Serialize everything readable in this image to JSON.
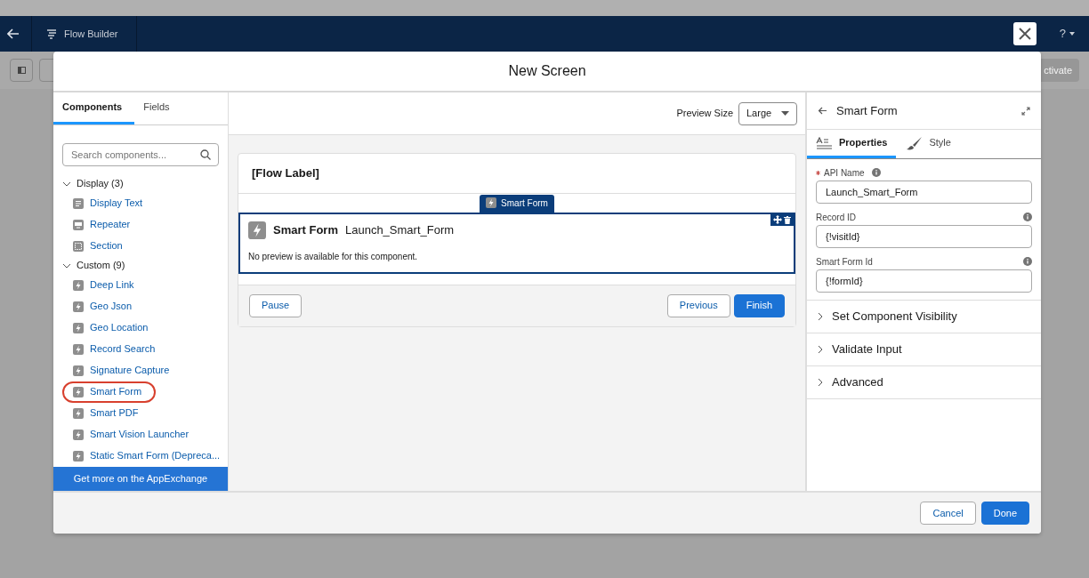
{
  "app_bar": {
    "title": "Flow Builder",
    "help": "?"
  },
  "toolbar": {
    "activate_label": "ctivate"
  },
  "modal": {
    "title": "New Screen",
    "left_tabs": [
      {
        "label": "Components",
        "selected": true
      },
      {
        "label": "Fields",
        "selected": false
      }
    ],
    "search": {
      "placeholder": "Search components..."
    },
    "groups": [
      {
        "label": "Display (3)",
        "expanded": true,
        "children": [
          {
            "label": "Display Text",
            "kind": "text",
            "highlighted": false
          },
          {
            "label": "Repeater",
            "kind": "repeater",
            "highlighted": false
          },
          {
            "label": "Section",
            "kind": "section",
            "highlighted": false
          }
        ]
      },
      {
        "label": "Custom (9)",
        "expanded": true,
        "children": [
          {
            "label": "Deep Link",
            "kind": "custom",
            "highlighted": false
          },
          {
            "label": "Geo Json",
            "kind": "custom",
            "highlighted": false
          },
          {
            "label": "Geo Location",
            "kind": "custom",
            "highlighted": false
          },
          {
            "label": "Record Search",
            "kind": "custom",
            "highlighted": false
          },
          {
            "label": "Signature Capture",
            "kind": "custom",
            "highlighted": false
          },
          {
            "label": "Smart Form",
            "kind": "custom",
            "highlighted": true
          },
          {
            "label": "Smart PDF",
            "kind": "custom",
            "highlighted": false
          },
          {
            "label": "Smart Vision Launcher",
            "kind": "custom",
            "highlighted": false
          },
          {
            "label": "Static Smart Form (Depreca...",
            "kind": "custom",
            "highlighted": false
          }
        ]
      }
    ],
    "appexchange_link": "Get more on the AppExchange",
    "preview_size": {
      "label": "Preview Size",
      "value": "Large"
    },
    "canvas": {
      "flow_label": "[Flow Label]",
      "component_tag": "Smart Form",
      "component": {
        "type": "Smart Form",
        "api_name": "Launch_Smart_Form",
        "message": "No preview is available for this component.",
        "selected": true
      },
      "buttons": [
        {
          "label": "Pause",
          "kind": "neutral"
        },
        {
          "label": "Previous",
          "kind": "neutral"
        },
        {
          "label": "Finish",
          "kind": "brand"
        }
      ]
    },
    "properties": {
      "title": "Smart Form",
      "tabs": [
        {
          "label": "Properties",
          "selected": true
        },
        {
          "label": "Style",
          "selected": false
        }
      ],
      "fields": [
        {
          "label": "API Name",
          "required": true,
          "value": "Launch_Smart_Form"
        },
        {
          "label": "Record ID",
          "required": false,
          "value": "{!visitId}"
        },
        {
          "label": "Smart Form Id",
          "required": false,
          "value": "{!formId}"
        }
      ],
      "sections": [
        {
          "label": "Set Component Visibility",
          "expanded": false
        },
        {
          "label": "Validate Input",
          "expanded": false
        },
        {
          "label": "Advanced",
          "expanded": false
        }
      ]
    },
    "footer_buttons": [
      {
        "label": "Cancel",
        "kind": "neutral"
      },
      {
        "label": "Done",
        "kind": "brand"
      }
    ]
  }
}
